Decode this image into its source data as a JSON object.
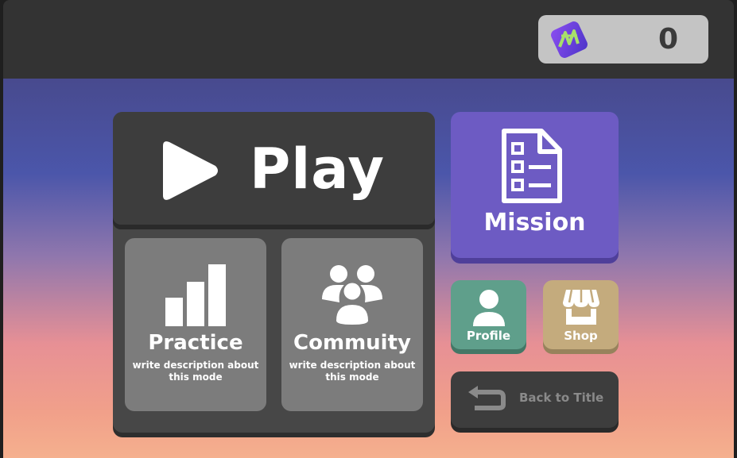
{
  "topbar": {
    "currency": {
      "icon": "gem-icon",
      "value": "0"
    }
  },
  "menu": {
    "play": {
      "label": "Play",
      "icon": "play-icon"
    },
    "practice": {
      "title": "Practice",
      "description": "write description about this mode",
      "icon": "bar-chart-icon"
    },
    "community": {
      "title": "Commuity",
      "description": "write description about this mode",
      "icon": "group-icon"
    },
    "mission": {
      "label": "Mission",
      "icon": "checklist-icon"
    },
    "profile": {
      "label": "Profile",
      "icon": "user-icon"
    },
    "shop": {
      "label": "Shop",
      "icon": "store-icon"
    },
    "back": {
      "label": "Back to Title",
      "icon": "return-arrow-icon"
    }
  },
  "colors": {
    "topbar": "#333333",
    "mission": "#6d5bc3",
    "profile": "#5f9f8b",
    "shop": "#c4ab7d",
    "panel": "#474747",
    "card": "#7c7c7c"
  }
}
